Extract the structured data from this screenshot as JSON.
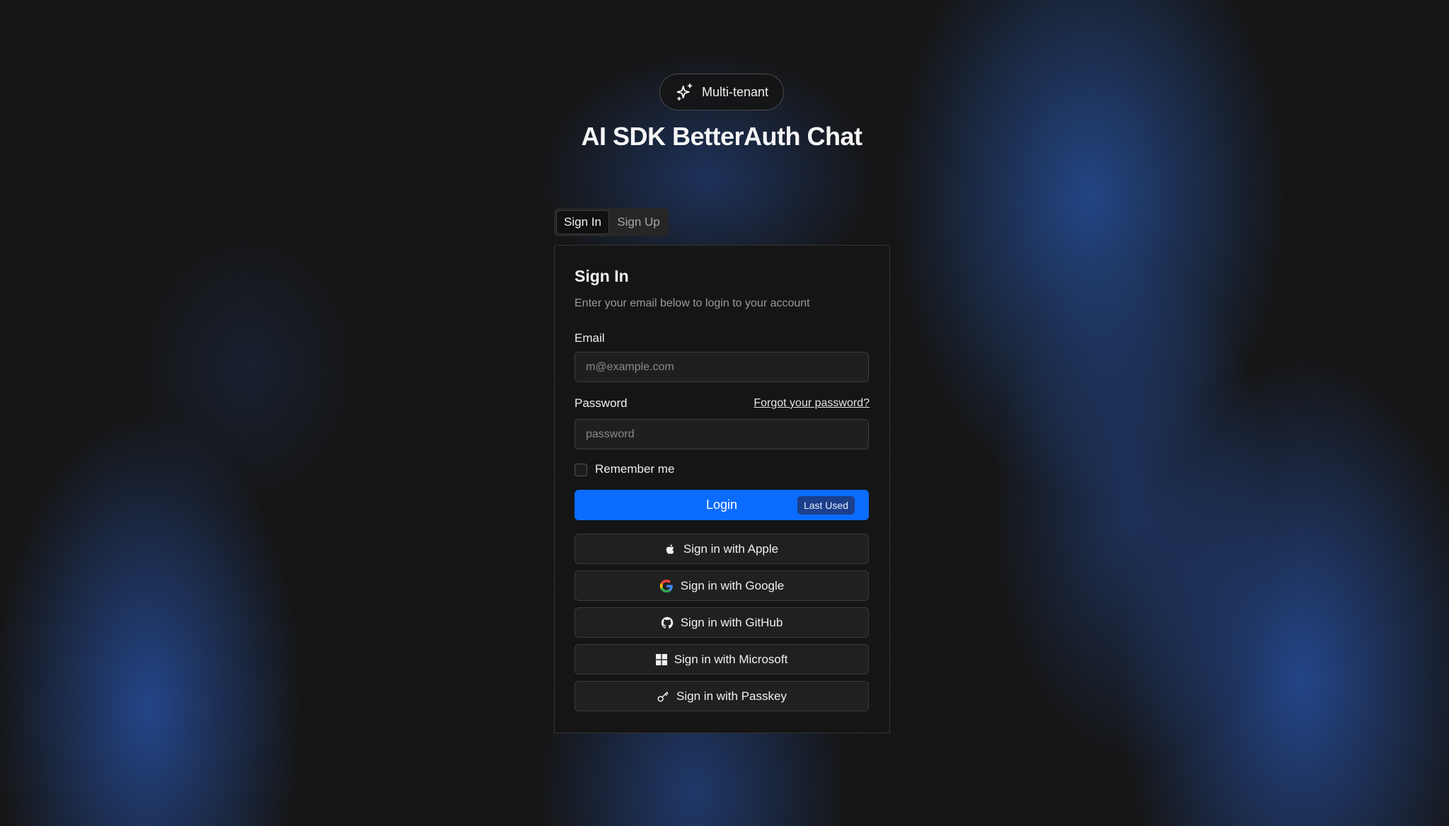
{
  "header": {
    "badge_label": "Multi-tenant",
    "title": "AI SDK BetterAuth Chat"
  },
  "tabs": [
    {
      "label": "Sign In",
      "active": true
    },
    {
      "label": "Sign Up",
      "active": false
    }
  ],
  "card": {
    "title": "Sign In",
    "subtitle": "Enter your email below to login to your account",
    "email": {
      "label": "Email",
      "placeholder": "m@example.com",
      "value": ""
    },
    "password": {
      "label": "Password",
      "placeholder": "password",
      "value": "",
      "forgot_link": "Forgot your password?"
    },
    "remember_me": {
      "label": "Remember me",
      "checked": false
    },
    "login": {
      "label": "Login",
      "badge": "Last Used"
    },
    "social_buttons": [
      {
        "label": "Sign in with Apple",
        "icon": "apple-icon"
      },
      {
        "label": "Sign in with Google",
        "icon": "google-icon"
      },
      {
        "label": "Sign in with GitHub",
        "icon": "github-icon"
      },
      {
        "label": "Sign in with Microsoft",
        "icon": "microsoft-icon"
      },
      {
        "label": "Sign in with Passkey",
        "icon": "key-icon"
      }
    ]
  },
  "colors": {
    "accent": "#0b6cff",
    "last_used_badge": "#1b3f8c",
    "background": "#141414",
    "card": "#151515"
  }
}
